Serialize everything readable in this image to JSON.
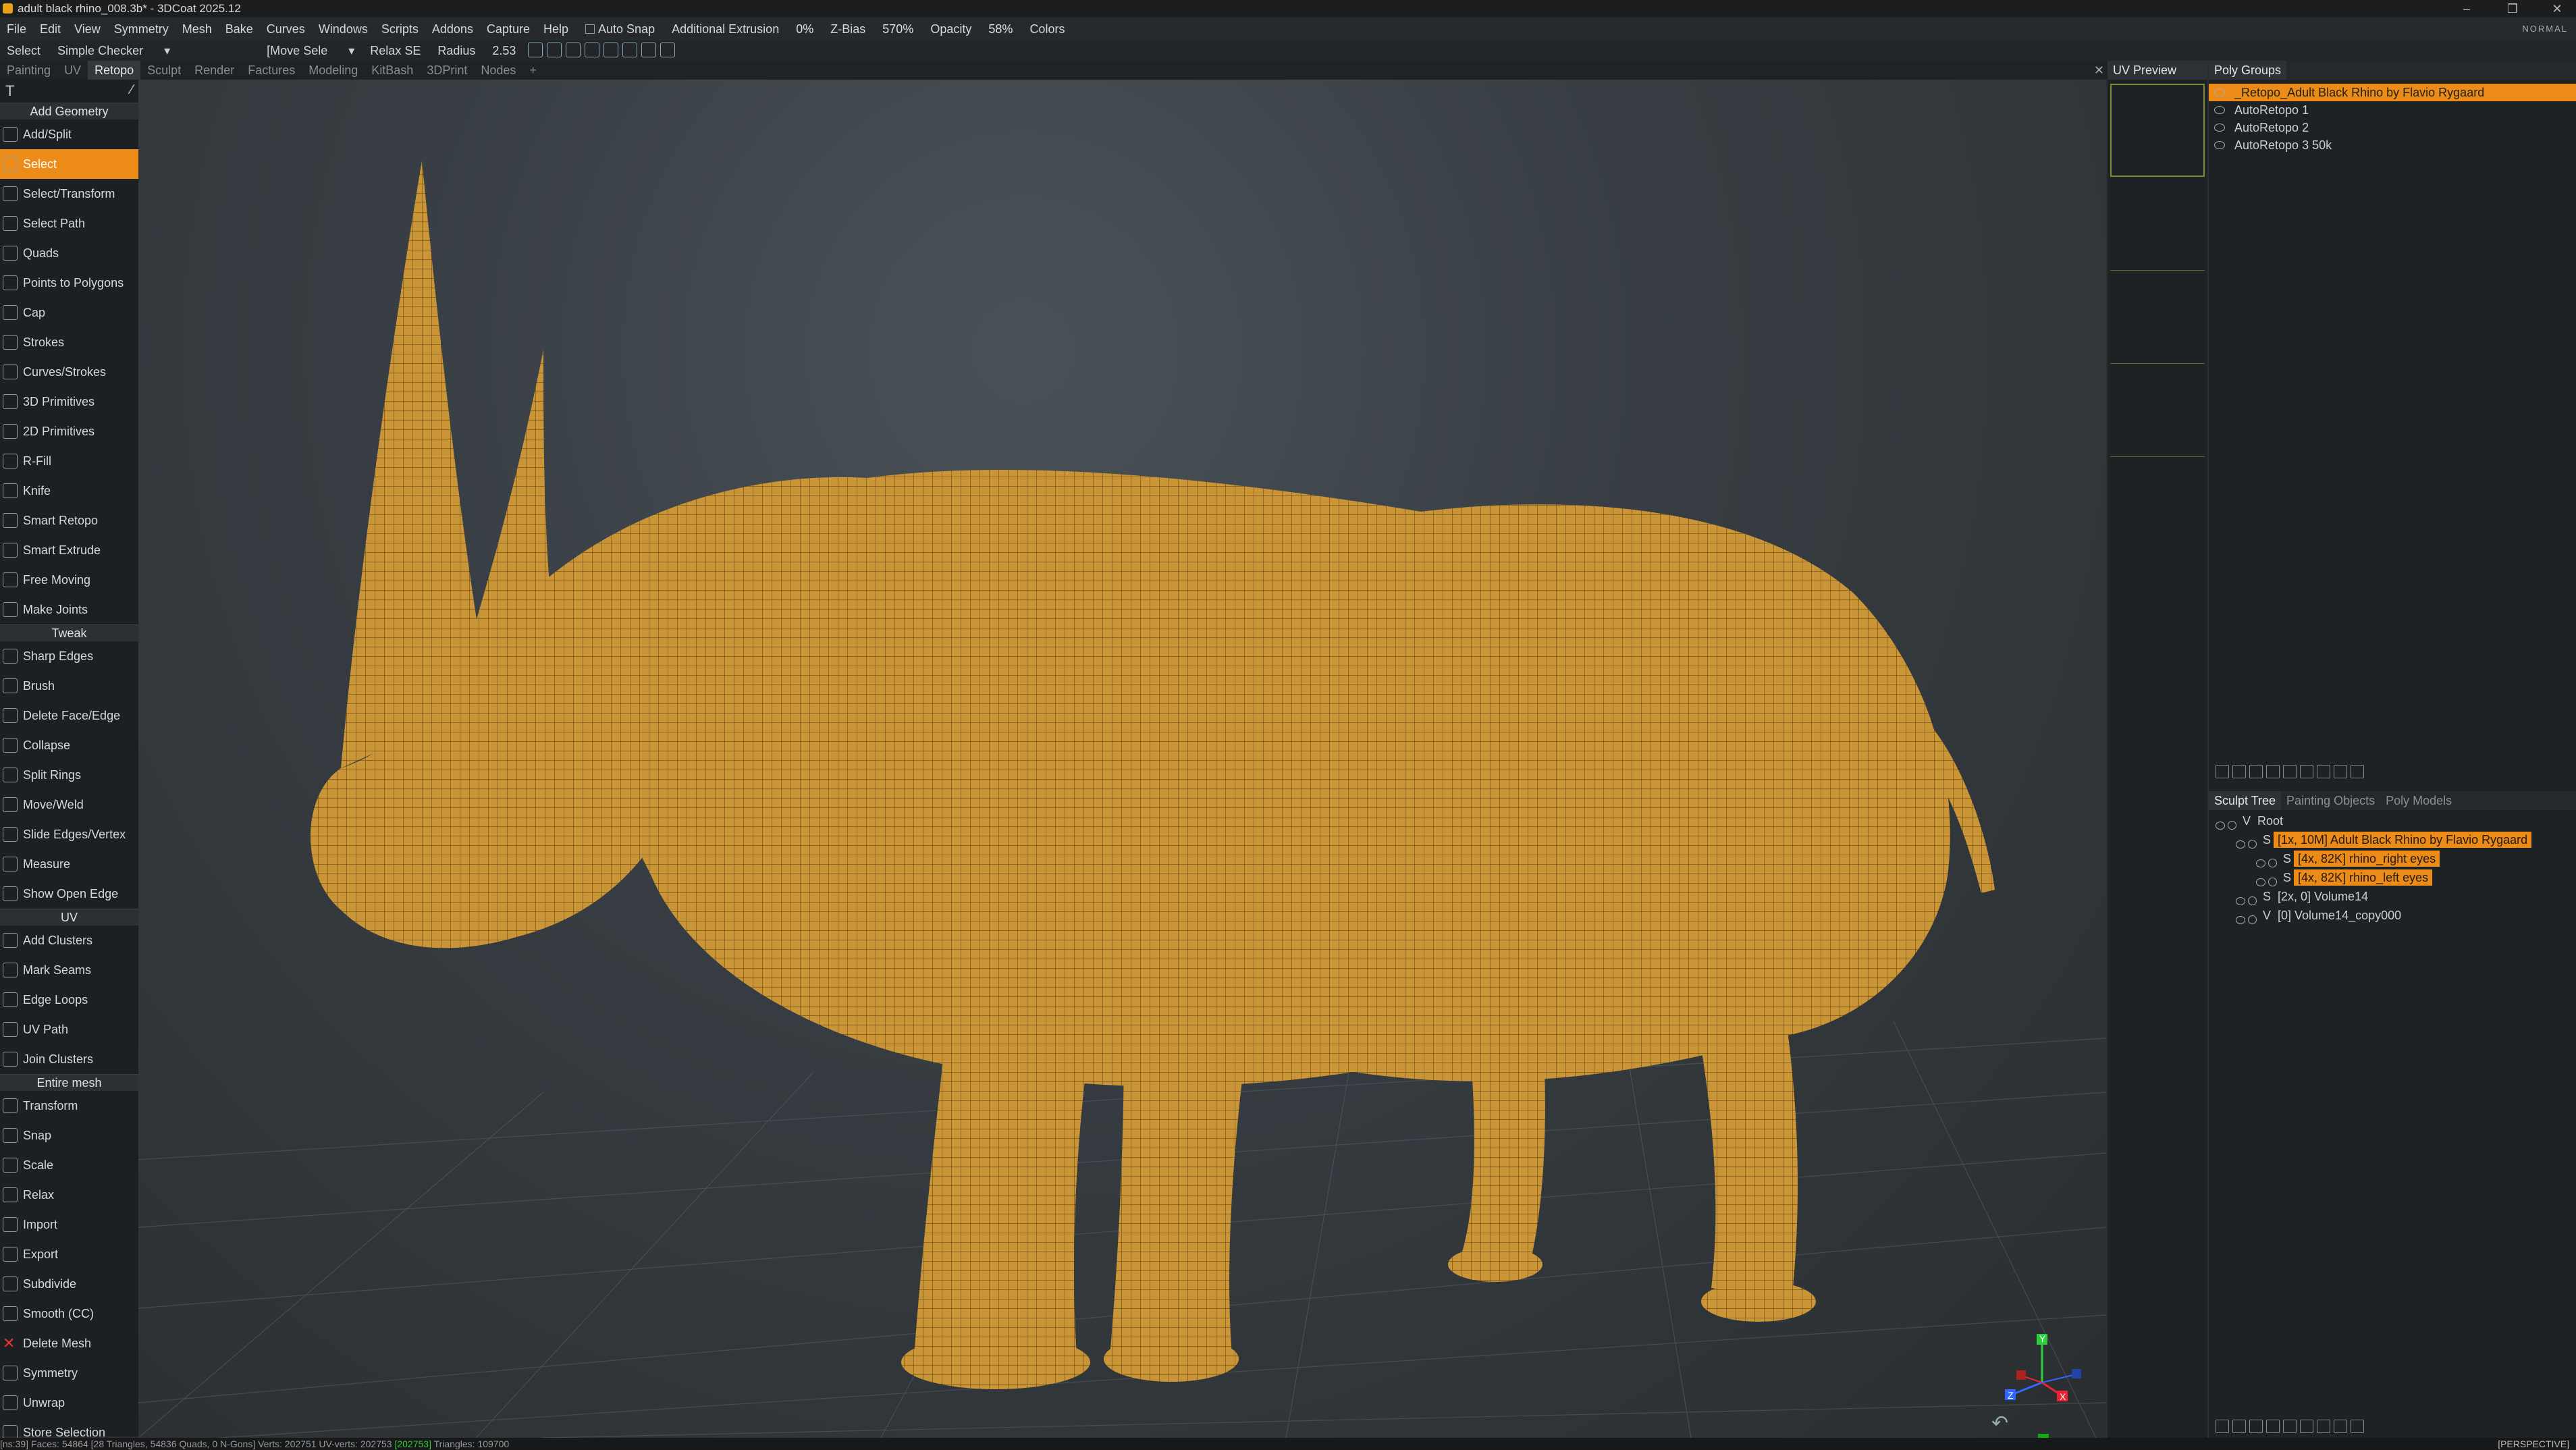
{
  "window": {
    "title": "adult black rhino_008.3b* - 3DCoat 2025.12",
    "corner_label": "NORMAL",
    "projection": "[PERSPECTIVE]"
  },
  "menubar": {
    "items": [
      "File",
      "Edit",
      "View",
      "Symmetry",
      "Mesh",
      "Bake",
      "Curves",
      "Windows",
      "Scripts",
      "Addons",
      "Capture",
      "Help"
    ],
    "auto_snap": "Auto Snap",
    "additional_extrusion": "Additional Extrusion",
    "extrusion_value": "0%",
    "zbias_label": "Z-Bias",
    "zbias_value": "570%",
    "opacity_label": "Opacity",
    "opacity_value": "58%",
    "colors_label": "Colors"
  },
  "toolbar": {
    "mode": "Select",
    "checker": "Simple Checker",
    "move_mode": "[Move Sele",
    "relax": "Relax SE",
    "radius_label": "Radius",
    "radius_value": "2.53"
  },
  "rooms": {
    "tabs": [
      "Painting",
      "UV",
      "Retopo",
      "Sculpt",
      "Render",
      "Factures",
      "Modeling",
      "KitBash",
      "3DPrint",
      "Nodes"
    ],
    "active": "Retopo",
    "add": "+"
  },
  "left_tools": {
    "section_add_geometry": "Add Geometry",
    "add_geometry": [
      "Add/Split",
      "Select",
      "Select/Transform",
      "Select Path",
      "Quads",
      "Points to Polygons",
      "Cap",
      "Strokes",
      "Curves/Strokes",
      "3D Primitives",
      "2D Primitives",
      "R-Fill",
      "Knife",
      "Smart Retopo",
      "Smart Extrude",
      "Free Moving",
      "Make Joints"
    ],
    "selected_tool": "Select",
    "section_tweak": "Tweak",
    "tweak": [
      "Sharp Edges",
      "Brush",
      "Delete Face/Edge",
      "Collapse",
      "Split Rings",
      "Move/Weld",
      "Slide Edges/Vertex",
      "Measure",
      "Show Open Edge"
    ],
    "section_uv": "UV",
    "uv": [
      "Add Clusters",
      "Mark Seams",
      "Edge Loops",
      "UV Path",
      "Join Clusters"
    ],
    "section_entire_mesh": "Entire mesh",
    "entire_mesh": [
      "Transform",
      "Snap",
      "Scale",
      "Relax",
      "Import",
      "Export",
      "Subdivide",
      "Smooth (CC)",
      "Delete Mesh",
      "Symmetry",
      "Unwrap",
      "Store Selection"
    ]
  },
  "uv_preview": {
    "tab": "UV Preview"
  },
  "poly_groups": {
    "tab": "Poly Groups",
    "items": [
      "_Retopo_Adult Black Rhino by Flavio Rygaard",
      "AutoRetopo 1",
      "AutoRetopo 2",
      "AutoRetopo 3 50k"
    ],
    "selected": "_Retopo_Adult Black Rhino by Flavio Rygaard"
  },
  "sculpt_tree": {
    "tabs": [
      "Sculpt Tree",
      "Painting Objects",
      "Poly Models"
    ],
    "active": "Sculpt Tree",
    "nodes": [
      {
        "type": "V",
        "label": "Root",
        "highlight": false,
        "indent": 0
      },
      {
        "type": "S",
        "label": "[1x, 10M] Adult Black Rhino by Flavio Rygaard",
        "highlight": true,
        "indent": 1
      },
      {
        "type": "S",
        "label": "[4x, 82K] rhino_right eyes",
        "highlight": true,
        "indent": 2
      },
      {
        "type": "S",
        "label": "[4x, 82K] rhino_left eyes",
        "highlight": true,
        "indent": 2
      },
      {
        "type": "S",
        "label": "[2x, 0] Volume14",
        "highlight": false,
        "indent": 1
      },
      {
        "type": "V",
        "label": "[0] Volume14_copy000",
        "highlight": false,
        "indent": 1
      }
    ]
  },
  "gizmo": {
    "x": "X",
    "y": "Y",
    "z": "Z"
  },
  "status": {
    "text": "[ns:39]     Faces: 54864 [28 Triangles, 54836 Quads, 0 N-Gons]  Verts: 202751  UV-verts: 202753 ",
    "highlight": "[202753]",
    "tail": " Triangles: 109700"
  },
  "colors": {
    "accent": "#ec8b17",
    "mesh": "#c99536",
    "viewport_bg": "#363c41"
  }
}
